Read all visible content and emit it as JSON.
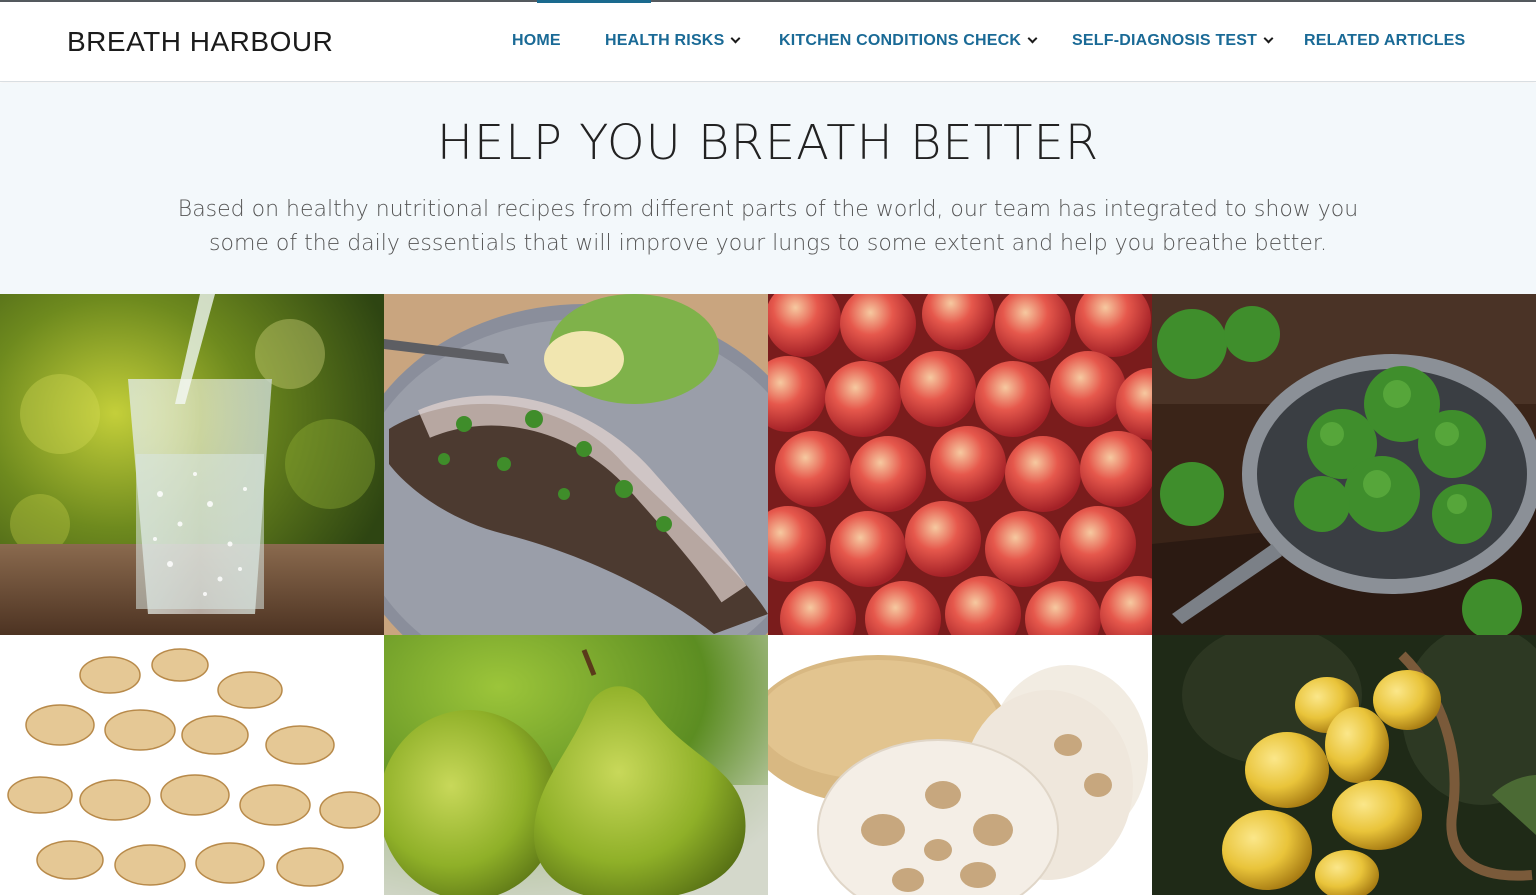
{
  "site": {
    "brand": "BREATH HARBOUR"
  },
  "nav": {
    "items": [
      {
        "label": "HOME",
        "has_dropdown": false,
        "active": true
      },
      {
        "label": "HEALTH RISKS",
        "has_dropdown": true,
        "active": false
      },
      {
        "label": "KITCHEN CONDITIONS CHECK",
        "has_dropdown": true,
        "active": false
      },
      {
        "label": "SELF-DIAGNOSIS TEST",
        "has_dropdown": true,
        "active": false
      },
      {
        "label": "RELATED ARTICLES",
        "has_dropdown": false,
        "active": false
      }
    ],
    "dropdown_icon": "chevron-down-icon"
  },
  "hero": {
    "title": "HELP YOU BREATH BETTER",
    "description": "Based on healthy nutritional recipes from different parts of the world, our team has integrated to show you some of the daily essentials that will improve your lungs to some extent and help you breathe better."
  },
  "gallery": {
    "images": [
      {
        "subject": "glass-of-water"
      },
      {
        "subject": "grilled-fish"
      },
      {
        "subject": "apples"
      },
      {
        "subject": "broccoli"
      },
      {
        "subject": "dried-lily-bulb"
      },
      {
        "subject": "pears"
      },
      {
        "subject": "lotus-root"
      },
      {
        "subject": "loquats"
      }
    ]
  },
  "colors": {
    "nav_link": "#1a6a96",
    "hero_background": "#f3f8fb",
    "active_indicator": "#1a6a8e"
  }
}
